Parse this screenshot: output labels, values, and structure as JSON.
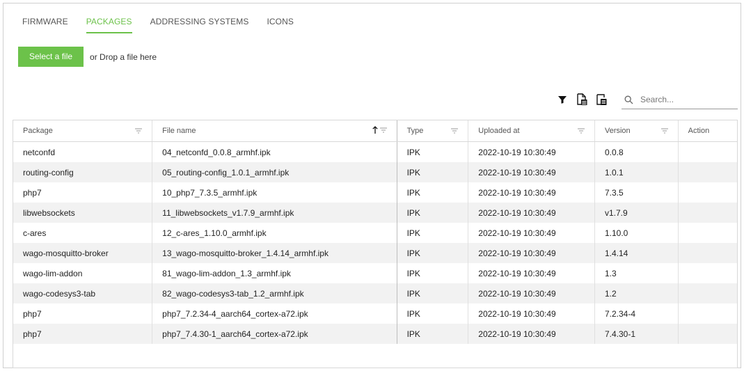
{
  "tabs": [
    {
      "label": "FIRMWARE",
      "active": false
    },
    {
      "label": "PACKAGES",
      "active": true
    },
    {
      "label": "ADDRESSING SYSTEMS",
      "active": false
    },
    {
      "label": "ICONS",
      "active": false
    }
  ],
  "upload": {
    "select_label": "Select a file",
    "drop_label": "or Drop a file here"
  },
  "toolbar": {
    "icons": [
      "filter-icon",
      "export-csv-icon",
      "export-pdf-icon"
    ],
    "search_placeholder": "Search..."
  },
  "colors": {
    "accent": "#6cc24a",
    "row_alt": "#f2f2f2"
  },
  "table": {
    "columns": [
      "Package",
      "File name",
      "Type",
      "Uploaded at",
      "Version",
      "Action"
    ],
    "sorted_column": "File name",
    "sort_direction": "ascending",
    "rows": [
      [
        "netconfd",
        "04_netconfd_0.0.8_armhf.ipk",
        "IPK",
        "2022-10-19 10:30:49",
        "0.0.8",
        ""
      ],
      [
        "routing-config",
        "05_routing-config_1.0.1_armhf.ipk",
        "IPK",
        "2022-10-19 10:30:49",
        "1.0.1",
        ""
      ],
      [
        "php7",
        "10_php7_7.3.5_armhf.ipk",
        "IPK",
        "2022-10-19 10:30:49",
        "7.3.5",
        ""
      ],
      [
        "libwebsockets",
        "11_libwebsockets_v1.7.9_armhf.ipk",
        "IPK",
        "2022-10-19 10:30:49",
        "v1.7.9",
        ""
      ],
      [
        "c-ares",
        "12_c-ares_1.10.0_armhf.ipk",
        "IPK",
        "2022-10-19 10:30:49",
        "1.10.0",
        ""
      ],
      [
        "wago-mosquitto-broker",
        "13_wago-mosquitto-broker_1.4.14_armhf.ipk",
        "IPK",
        "2022-10-19 10:30:49",
        "1.4.14",
        ""
      ],
      [
        "wago-lim-addon",
        "81_wago-lim-addon_1.3_armhf.ipk",
        "IPK",
        "2022-10-19 10:30:49",
        "1.3",
        ""
      ],
      [
        "wago-codesys3-tab",
        "82_wago-codesys3-tab_1.2_armhf.ipk",
        "IPK",
        "2022-10-19 10:30:49",
        "1.2",
        ""
      ],
      [
        "php7",
        "php7_7.2.34-4_aarch64_cortex-a72.ipk",
        "IPK",
        "2022-10-19 10:30:49",
        "7.2.34-4",
        ""
      ],
      [
        "php7",
        "php7_7.4.30-1_aarch64_cortex-a72.ipk",
        "IPK",
        "2022-10-19 10:30:49",
        "7.4.30-1",
        ""
      ]
    ]
  }
}
